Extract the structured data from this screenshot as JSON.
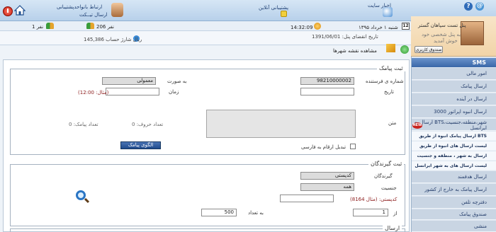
{
  "header": {
    "user_link": "ارتباط بانواحدپشتیبانی",
    "user_sub": "ارسال تیــکت",
    "support_label": "پشتیبانی آنلاین",
    "news_label": "اخبار سایت",
    "help_glyph": "?",
    "at_glyph": "@"
  },
  "infobar": {
    "date": "شنبه ۱ خرداد ۱۳۹۵",
    "time": "14:32:09",
    "users_count": "206 نفر",
    "online_count": "1 نفر",
    "calendar_day": "12"
  },
  "account": {
    "expiry": "تاریخ انقضای پنل: 1391/06/01",
    "balance": "145,386 ریال شارژ حساب"
  },
  "toolbar": {
    "map_label": "مشاهده نقشه شهرها"
  },
  "profile": {
    "name": "پنل تست سپاهان گستر",
    "welcome_1": "به پنل شخصی خود",
    "welcome_2": "خوش آمدید",
    "wallet_button": "صندوق کاربری"
  },
  "sidebar": {
    "heading": "SMS",
    "items": [
      "امور مالی",
      "ارسال پیامک",
      "ارسال در آینده",
      "ارسال انبوه اپراتور 3000",
      "ارسال به BTS،شهر،منطقه،جنسیت ایرانسل",
      "ارسال پیامک انبوه از طریق BTS ایرانسل",
      "لیست ارسال های انبوه از طریق BTS",
      "ارسال به شهر ، منطقه و جنسیت",
      "لیست ارسال های به شهر ایرانسل",
      "ارسال هدفمند",
      "ارسال پیامک به خارج از کشور",
      "دفترچه تلفن",
      "صندوق پیامک",
      "منشی"
    ],
    "new_badge": "NEW"
  },
  "sms_form": {
    "legend": "ثبت پیامک",
    "sender_label": "شماره ی فرستنده",
    "sender_value": "98210000002",
    "type_label": "به صورت",
    "type_value": "معمولی",
    "date_label": "تاریخ",
    "time_label": "زمان",
    "time_example": "(مثال: 12:00)",
    "text_label": "متن",
    "chars_label": "تعداد حروف: 0",
    "sms_count_label": "تعداد پیامک: 0",
    "convert_label": "تبدیل ارقام به فارسی",
    "pattern_button": "الگوی پیامک"
  },
  "recipients_form": {
    "legend": "ثبت گیرندگان",
    "recipients_label": "گیرندگان",
    "recipients_value": "کدپستی",
    "gender_label": "جنسیت",
    "gender_value": "همه",
    "postal_label": "کدپستی: (مثال 8164)",
    "from_label": "از",
    "from_value": "1",
    "count_label": "به تعداد",
    "count_value": "500"
  },
  "send_form": {
    "legend": "ارسال"
  }
}
